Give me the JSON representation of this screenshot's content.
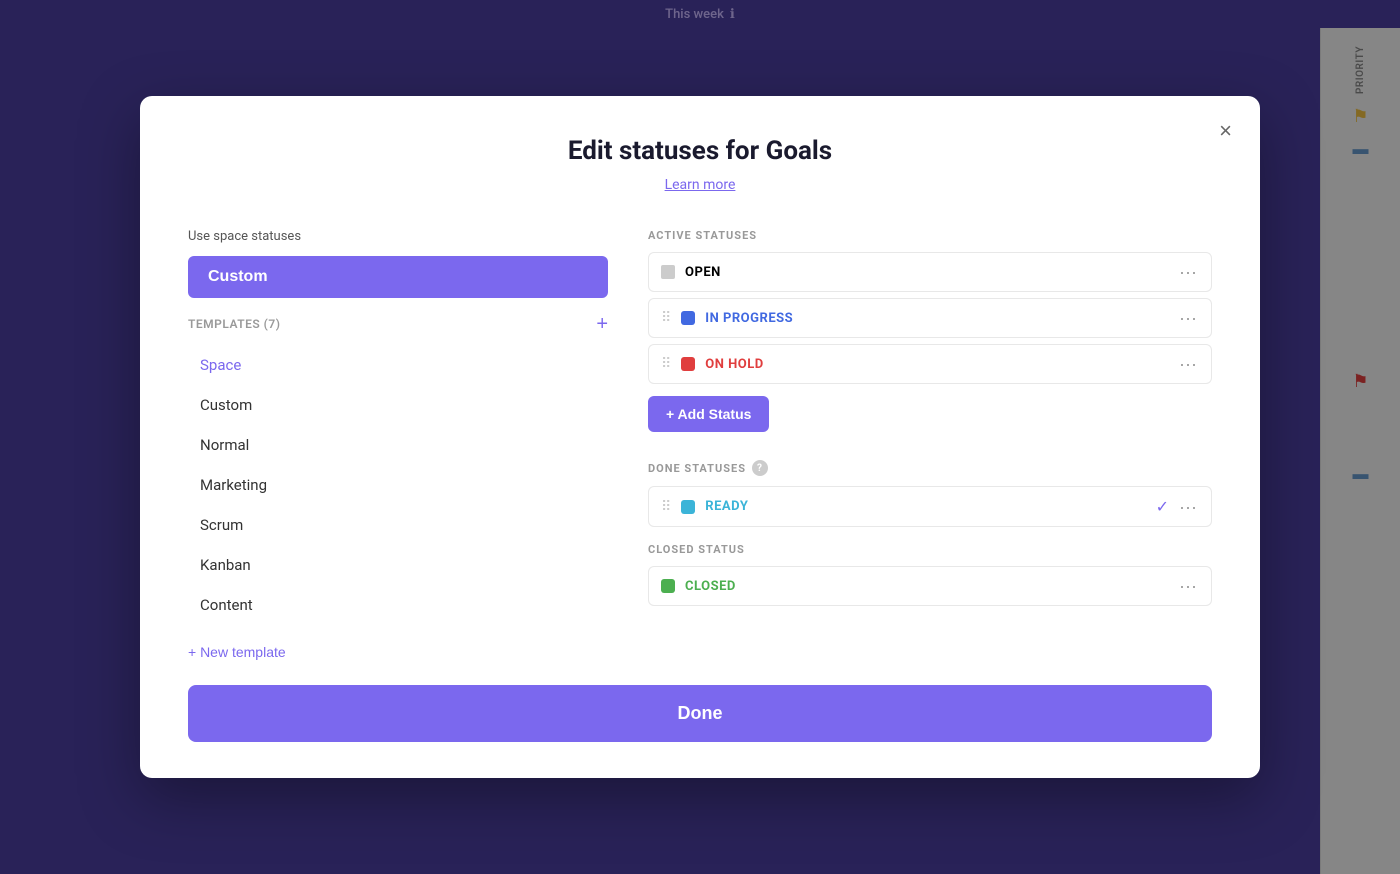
{
  "topbar": {
    "title": "This week",
    "info_icon": "ℹ"
  },
  "modal": {
    "title": "Edit statuses for Goals",
    "learn_more": "Learn more",
    "close_label": "×",
    "left": {
      "use_space_label": "Use space statuses",
      "custom_selected": "Custom",
      "templates_label": "TEMPLATES (7)",
      "plus_icon": "+",
      "templates": [
        {
          "label": "Space",
          "highlighted": true
        },
        {
          "label": "Custom",
          "highlighted": false
        },
        {
          "label": "Normal",
          "highlighted": false
        },
        {
          "label": "Marketing",
          "highlighted": false
        },
        {
          "label": "Scrum",
          "highlighted": false
        },
        {
          "label": "Kanban",
          "highlighted": false
        },
        {
          "label": "Content",
          "highlighted": false
        }
      ],
      "new_template_label": "+ New template"
    },
    "right": {
      "active_section_label": "ACTIVE STATUSES",
      "active_statuses": [
        {
          "name": "OPEN",
          "color": "gray",
          "hex": "#aaaaaa"
        },
        {
          "name": "IN PROGRESS",
          "color": "blue",
          "hex": "#4169e1"
        },
        {
          "name": "ON HOLD",
          "color": "red",
          "hex": "#e03e3e"
        }
      ],
      "add_status_label": "+ Add Status",
      "done_section_label": "DONE STATUSES",
      "done_statuses": [
        {
          "name": "READY",
          "color": "cyan",
          "hex": "#3bb4d8",
          "has_check": true
        }
      ],
      "closed_section_label": "CLOSED STATUS",
      "closed_statuses": [
        {
          "name": "CLOSED",
          "color": "green",
          "hex": "#4caf50",
          "has_check": false
        }
      ]
    },
    "done_button": "Done"
  },
  "priority_label": "PRIORITY"
}
